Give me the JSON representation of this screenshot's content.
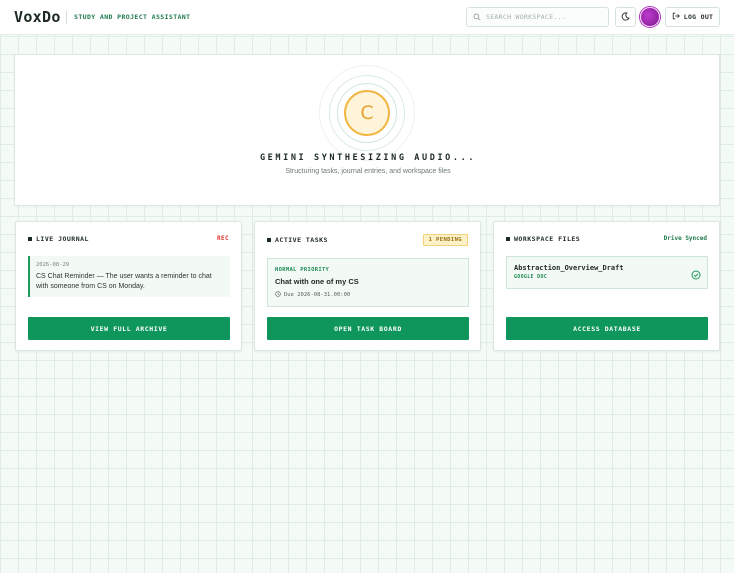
{
  "header": {
    "logo": "VoxDo",
    "tagline": "STUDY AND PROJECT ASSISTANT",
    "search_placeholder": "SEARCH WORKSPACE...",
    "logout_label": "LOG OUT"
  },
  "hero": {
    "orb_letter": "C",
    "title": "GEMINI SYNTHESIZING AUDIO...",
    "subtitle": "Structuring tasks, journal entries, and workspace files"
  },
  "journal": {
    "title": "LIVE JOURNAL",
    "status": "REC",
    "entry_date": "2026-08-29",
    "entry_text": "CS Chat Reminder — The user wants a reminder to chat with someone from CS on Monday.",
    "button_label": "VIEW FULL ARCHIVE"
  },
  "tasks": {
    "title": "ACTIVE TASKS",
    "badge": "1 PENDING",
    "priority": "NORMAL PRIORITY",
    "task_name": "Chat with one of my CS",
    "due": "Due 2026-08-31.00:00",
    "button_label": "OPEN TASK BOARD"
  },
  "files": {
    "title": "WORKSPACE FILES",
    "status": "Drive Synced",
    "file_name": "Abstraction_Overview_Draft",
    "file_type": "GOOGLE DOC",
    "button_label": "ACCESS DATABASE"
  },
  "colors": {
    "accent": "#0f965c",
    "rec": "#e3342f",
    "orb": "#f0b640",
    "avatar": "#b12fc2"
  },
  "icons": [
    "search-icon",
    "moon-icon",
    "logout-icon",
    "clock-icon",
    "check-circle-icon"
  ]
}
